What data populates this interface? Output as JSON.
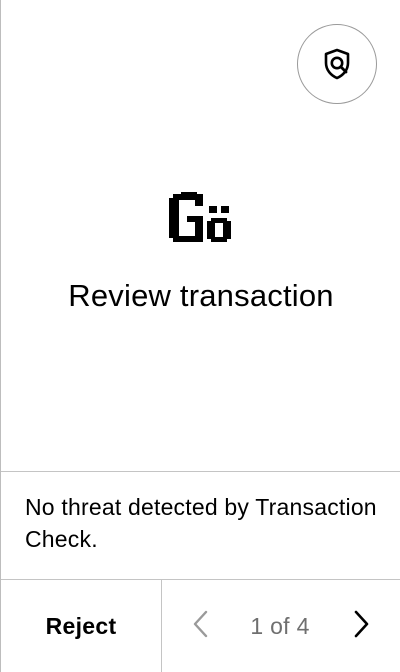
{
  "header": {
    "scan_icon": "shield-search-icon"
  },
  "app": {
    "logo_text": "Gö",
    "logo_icon": "pixel-logo-icon"
  },
  "main": {
    "title": "Review transaction"
  },
  "threat": {
    "message": "No threat detected by Transaction Check."
  },
  "footer": {
    "reject_label": "Reject",
    "prev_icon": "chevron-left-icon",
    "next_icon": "chevron-right-icon",
    "page_indicator": "1 of 4",
    "current_page": 1,
    "total_pages": 4
  },
  "colors": {
    "text": "#000000",
    "muted": "#6f6f6f",
    "divider": "#c4c4c4",
    "background": "#ffffff"
  }
}
